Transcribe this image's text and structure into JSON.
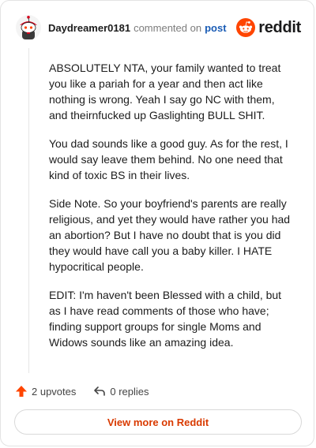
{
  "header": {
    "author": "Daydreamer0181",
    "verb": "commented on",
    "post_link": "post",
    "brand": "reddit"
  },
  "comment": {
    "paragraphs": [
      "ABSOLUTELY NTA, your family wanted to treat you like a pariah for a year and then act like nothing is wrong. Yeah I say go NC with them, and theirnfucked up Gaslighting BULL SHIT.",
      "You dad sounds like a good guy. As for the rest, I would say leave them behind. No one need that kind of toxic BS in their lives.",
      "Side Note. So your boyfriend's parents are really religious, and yet they would have rather you had an abortion? But I have no doubt that is you did they would have call you a baby killer. I HATE hypocritical people.",
      "EDIT: I'm haven't been Blessed with a child, but as I have read comments of those who have; finding support groups for single Moms and Widows sounds like an amazing idea."
    ]
  },
  "actions": {
    "upvotes": "2 upvotes",
    "replies": "0 replies"
  },
  "footer": {
    "view_more": "View more on Reddit"
  },
  "colors": {
    "brand_orange": "#ff4500",
    "link_blue": "#1a5cb5",
    "view_more_red": "#d93a00"
  },
  "icons": {
    "avatar": "snoo-avatar-icon",
    "brand": "reddit-logo-icon",
    "upvote": "upvote-arrow-icon",
    "reply": "reply-arrow-icon"
  }
}
